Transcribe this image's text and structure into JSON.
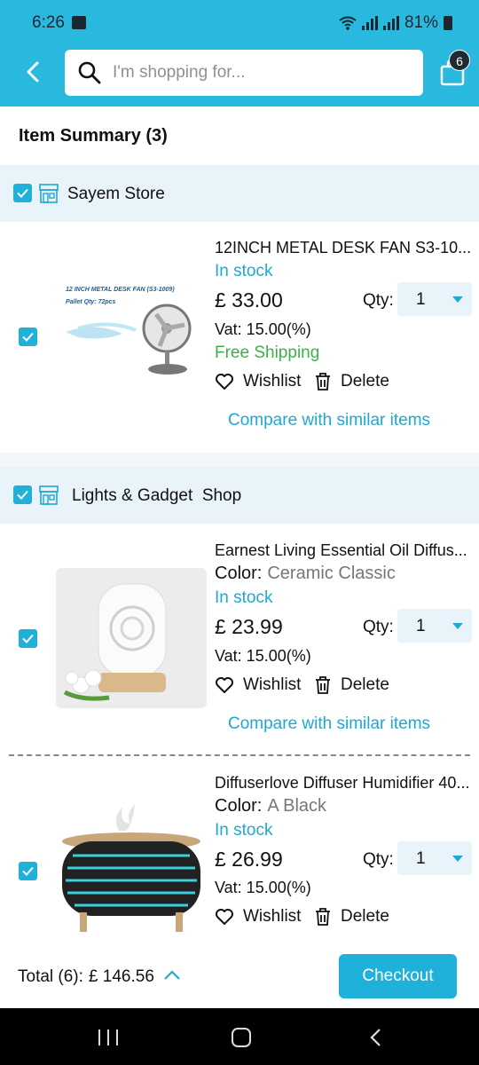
{
  "status": {
    "time": "6:26",
    "battery": "81%"
  },
  "header": {
    "search_placeholder": "I'm shopping for...",
    "cart_count": "6"
  },
  "summary": {
    "title": "Item Summary (3)"
  },
  "stores": [
    {
      "name": "Sayem Store",
      "items": [
        {
          "title": "12INCH METAL DESK FAN S3-10...",
          "image_caption": "12 INCH METAL DESK FAN (S3-1009)",
          "image_caption2": "Pallet Qty: 72pcs",
          "stock": "In stock",
          "price": "£ 33.00",
          "qty_label": "Qty:",
          "qty": "1",
          "vat": "Vat: 15.00(%)",
          "shipping": "Free Shipping",
          "wishlist": "Wishlist",
          "delete": "Delete",
          "compare": "Compare with similar items"
        }
      ]
    },
    {
      "name": "Lights & Gadget  Shop",
      "items": [
        {
          "title": "Earnest Living Essential Oil Diffus...",
          "color_label": "Color:",
          "color_value": "Ceramic Classic",
          "stock": "In stock",
          "price": "£ 23.99",
          "qty_label": "Qty:",
          "qty": "1",
          "vat": "Vat: 15.00(%)",
          "wishlist": "Wishlist",
          "delete": "Delete",
          "compare": "Compare with similar items"
        },
        {
          "title": "Diffuserlove Diffuser Humidifier 40...",
          "color_label": "Color:",
          "color_value": "A Black",
          "stock": "In stock",
          "price": "£ 26.99",
          "qty_label": "Qty:",
          "qty": "1",
          "vat": "Vat: 15.00(%)",
          "wishlist": "Wishlist",
          "delete": "Delete"
        }
      ]
    }
  ],
  "footer": {
    "total_label": "Total (6):",
    "total_amount": "£ 146.56",
    "checkout": "Checkout"
  },
  "colors": {
    "accent": "#29b9df",
    "link": "#1fa8d4",
    "shipping": "#3db04a",
    "store_bg": "#e8f3fa"
  }
}
